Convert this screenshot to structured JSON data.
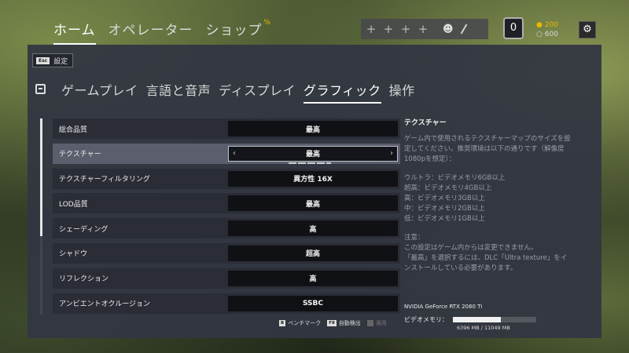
{
  "topnav": {
    "items": [
      {
        "label": "ホーム",
        "active": true
      },
      {
        "label": "オペレーター",
        "active": false
      },
      {
        "label": "ショップ",
        "active": false
      }
    ],
    "shop_badge": "%"
  },
  "squad": {
    "slots": [
      "+",
      "+",
      "+",
      "+"
    ]
  },
  "rank": {
    "value": "0"
  },
  "currency": {
    "renown": "200",
    "credits": "600"
  },
  "back_button": {
    "key": "Esc",
    "label": "設定"
  },
  "tabs": [
    {
      "label": "ゲームプレイ",
      "active": false
    },
    {
      "label": "言語と音声",
      "active": false
    },
    {
      "label": "ディスプレイ",
      "active": false
    },
    {
      "label": "グラフィック",
      "active": true
    },
    {
      "label": "操作",
      "active": false
    }
  ],
  "settings": [
    {
      "label": "総合品質",
      "value": "最高"
    },
    {
      "label": "テクスチャー",
      "value": "最高"
    },
    {
      "label": "テクスチャーフィルタリング",
      "value": "異方性 16X"
    },
    {
      "label": "LOD品質",
      "value": "最高"
    },
    {
      "label": "シェーディング",
      "value": "高"
    },
    {
      "label": "シャドウ",
      "value": "超高"
    },
    {
      "label": "リフレクション",
      "value": "高"
    },
    {
      "label": "アンビエントオクルージョン",
      "value": "SSBC"
    }
  ],
  "selected_index": 1,
  "description": {
    "title": "テクスチャー",
    "para1": "ゲーム内で使用されるテクスチャーマップのサイズを設定してください。推奨環境は以下の通りです（解像度1080pを想定）：",
    "list": [
      "ウルトラ：ビデオメモリ6GB以上",
      "超高：ビデオメモリ4GB以上",
      "高：ビデオメモリ3GB以上",
      "中：ビデオメモリ2GB以上",
      "低：ビデオメモリ1GB以上"
    ],
    "note_title": "注意：",
    "note1": "この設定はゲーム内からは変更できません。",
    "note2": "「最高」を選択するには、DLC「Ultra texture」をインストールしている必要があります。"
  },
  "gpu": {
    "name": "NVIDIA GeForce RTX 2080 Ti"
  },
  "vram": {
    "label": "ビデオメモリ：",
    "text": "6396 MB / 11049 MB",
    "used_fraction": 0.579
  },
  "footer": {
    "benchmark_key": "B",
    "benchmark_label": "ベンチマーク",
    "autodetect_key": "F8",
    "autodetect_label": "自動検出",
    "apply_key": "",
    "apply_label": "適用"
  },
  "colors": {
    "accent": "#e8b800",
    "panel": "#323642",
    "selected_row": "#5b5f6d"
  }
}
